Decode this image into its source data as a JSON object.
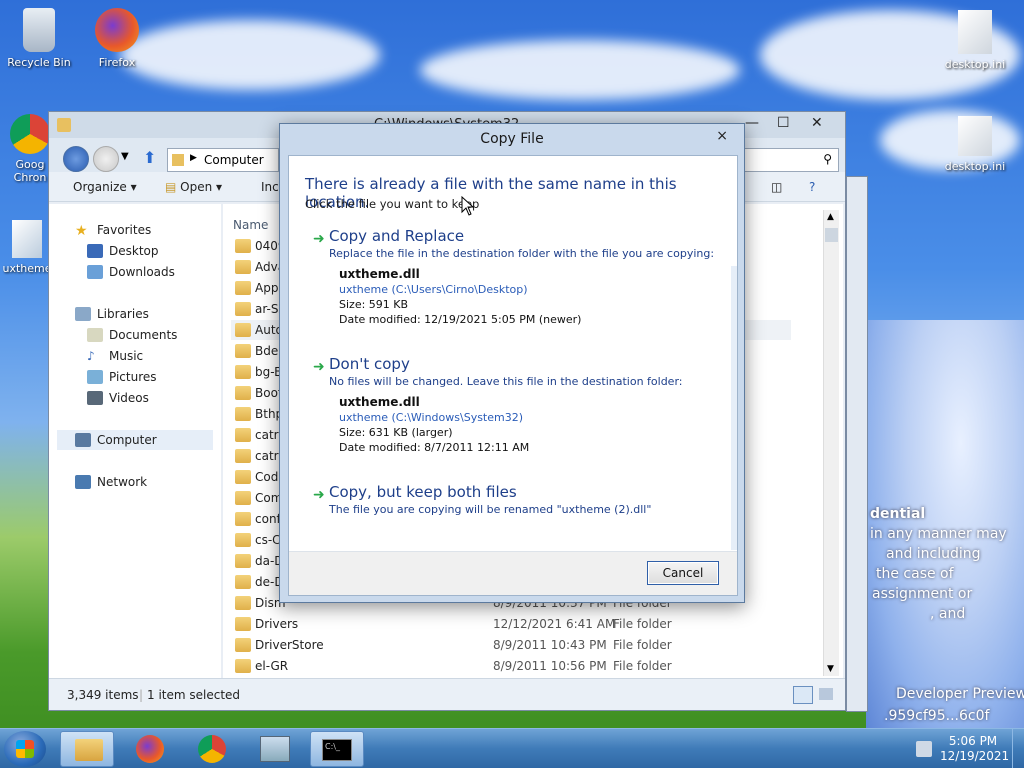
{
  "desktop": {
    "icons": [
      {
        "label": "Recycle Bin",
        "icon": "recycle-bin-icon"
      },
      {
        "label": "Firefox",
        "icon": "firefox-icon"
      },
      {
        "label": "Goog Chron",
        "icon": "chrome-icon"
      },
      {
        "label": "uxtheme",
        "icon": "file-icon"
      },
      {
        "label": "desktop.ini",
        "icon": "ini-file-icon"
      },
      {
        "label": "desktop.ini",
        "icon": "ini-file-icon"
      }
    ],
    "wallpaper_text": [
      "dential",
      "in any manner may",
      "and including",
      "the case of",
      "assignment or",
      ", and",
      "Developer Preview",
      ".959cf95...6c0f"
    ]
  },
  "explorer": {
    "title": "C:\\Windows\\System32",
    "address": "Computer",
    "toolbar": {
      "organize": "Organize",
      "open": "Open",
      "include": "Incl"
    },
    "nav": {
      "favorites": "Favorites",
      "desktop": "Desktop",
      "downloads": "Downloads",
      "libraries": "Libraries",
      "documents": "Documents",
      "music": "Music",
      "pictures": "Pictures",
      "videos": "Videos",
      "computer": "Computer",
      "network": "Network"
    },
    "columns": {
      "name": "Name"
    },
    "rows": [
      {
        "name": "0409",
        "date": "",
        "type": ""
      },
      {
        "name": "Adva",
        "date": "",
        "type": ""
      },
      {
        "name": "AppL",
        "date": "",
        "type": ""
      },
      {
        "name": "ar-SA",
        "date": "",
        "type": ""
      },
      {
        "name": "Auto",
        "date": "",
        "type": ""
      },
      {
        "name": "BdeU",
        "date": "",
        "type": ""
      },
      {
        "name": "bg-B",
        "date": "",
        "type": ""
      },
      {
        "name": "Boot",
        "date": "",
        "type": ""
      },
      {
        "name": "Bthp",
        "date": "",
        "type": ""
      },
      {
        "name": "catro",
        "date": "",
        "type": ""
      },
      {
        "name": "catro",
        "date": "",
        "type": ""
      },
      {
        "name": "Code",
        "date": "",
        "type": ""
      },
      {
        "name": "Com",
        "date": "",
        "type": ""
      },
      {
        "name": "confi",
        "date": "",
        "type": ""
      },
      {
        "name": "cs-CZ",
        "date": "",
        "type": ""
      },
      {
        "name": "da-D",
        "date": "",
        "type": ""
      },
      {
        "name": "de-D",
        "date": "",
        "type": ""
      },
      {
        "name": "Dism",
        "date": "8/9/2011 10:37 PM",
        "type": "File folder"
      },
      {
        "name": "Drivers",
        "date": "12/12/2021 6:41 AM",
        "type": "File folder"
      },
      {
        "name": "DriverStore",
        "date": "8/9/2011 10:43 PM",
        "type": "File folder"
      },
      {
        "name": "el-GR",
        "date": "8/9/2011 10:56 PM",
        "type": "File folder"
      }
    ],
    "status": {
      "count": "3,349 items",
      "selected": "1 item selected"
    }
  },
  "dialog": {
    "title": "Copy File",
    "heading": "There is already a file with the same name in this location.",
    "subheading": "Click the file you want to keep",
    "replace": {
      "title": "Copy and Replace",
      "desc": "Replace the file in the destination folder with the file you are copying:",
      "file_name": "uxtheme.dll",
      "file_path": "uxtheme (C:\\Users\\Cirno\\Desktop)",
      "size": "Size: 591 KB",
      "date": "Date modified: 12/19/2021 5:05 PM (newer)"
    },
    "dont_copy": {
      "title": "Don't copy",
      "desc": "No files will be changed. Leave this file in the destination folder:",
      "file_name": "uxtheme.dll",
      "file_path": "uxtheme (C:\\Windows\\System32)",
      "size": "Size: 631 KB (larger)",
      "date": "Date modified: 8/7/2011 12:11 AM"
    },
    "keep_both": {
      "title": "Copy, but keep both files",
      "desc": "The file you are copying will be renamed \"uxtheme (2).dll\""
    },
    "cancel_label": "Cancel",
    "close_glyph": "×"
  },
  "taskbar": {
    "time": "5:06 PM",
    "date": "12/19/2021"
  }
}
